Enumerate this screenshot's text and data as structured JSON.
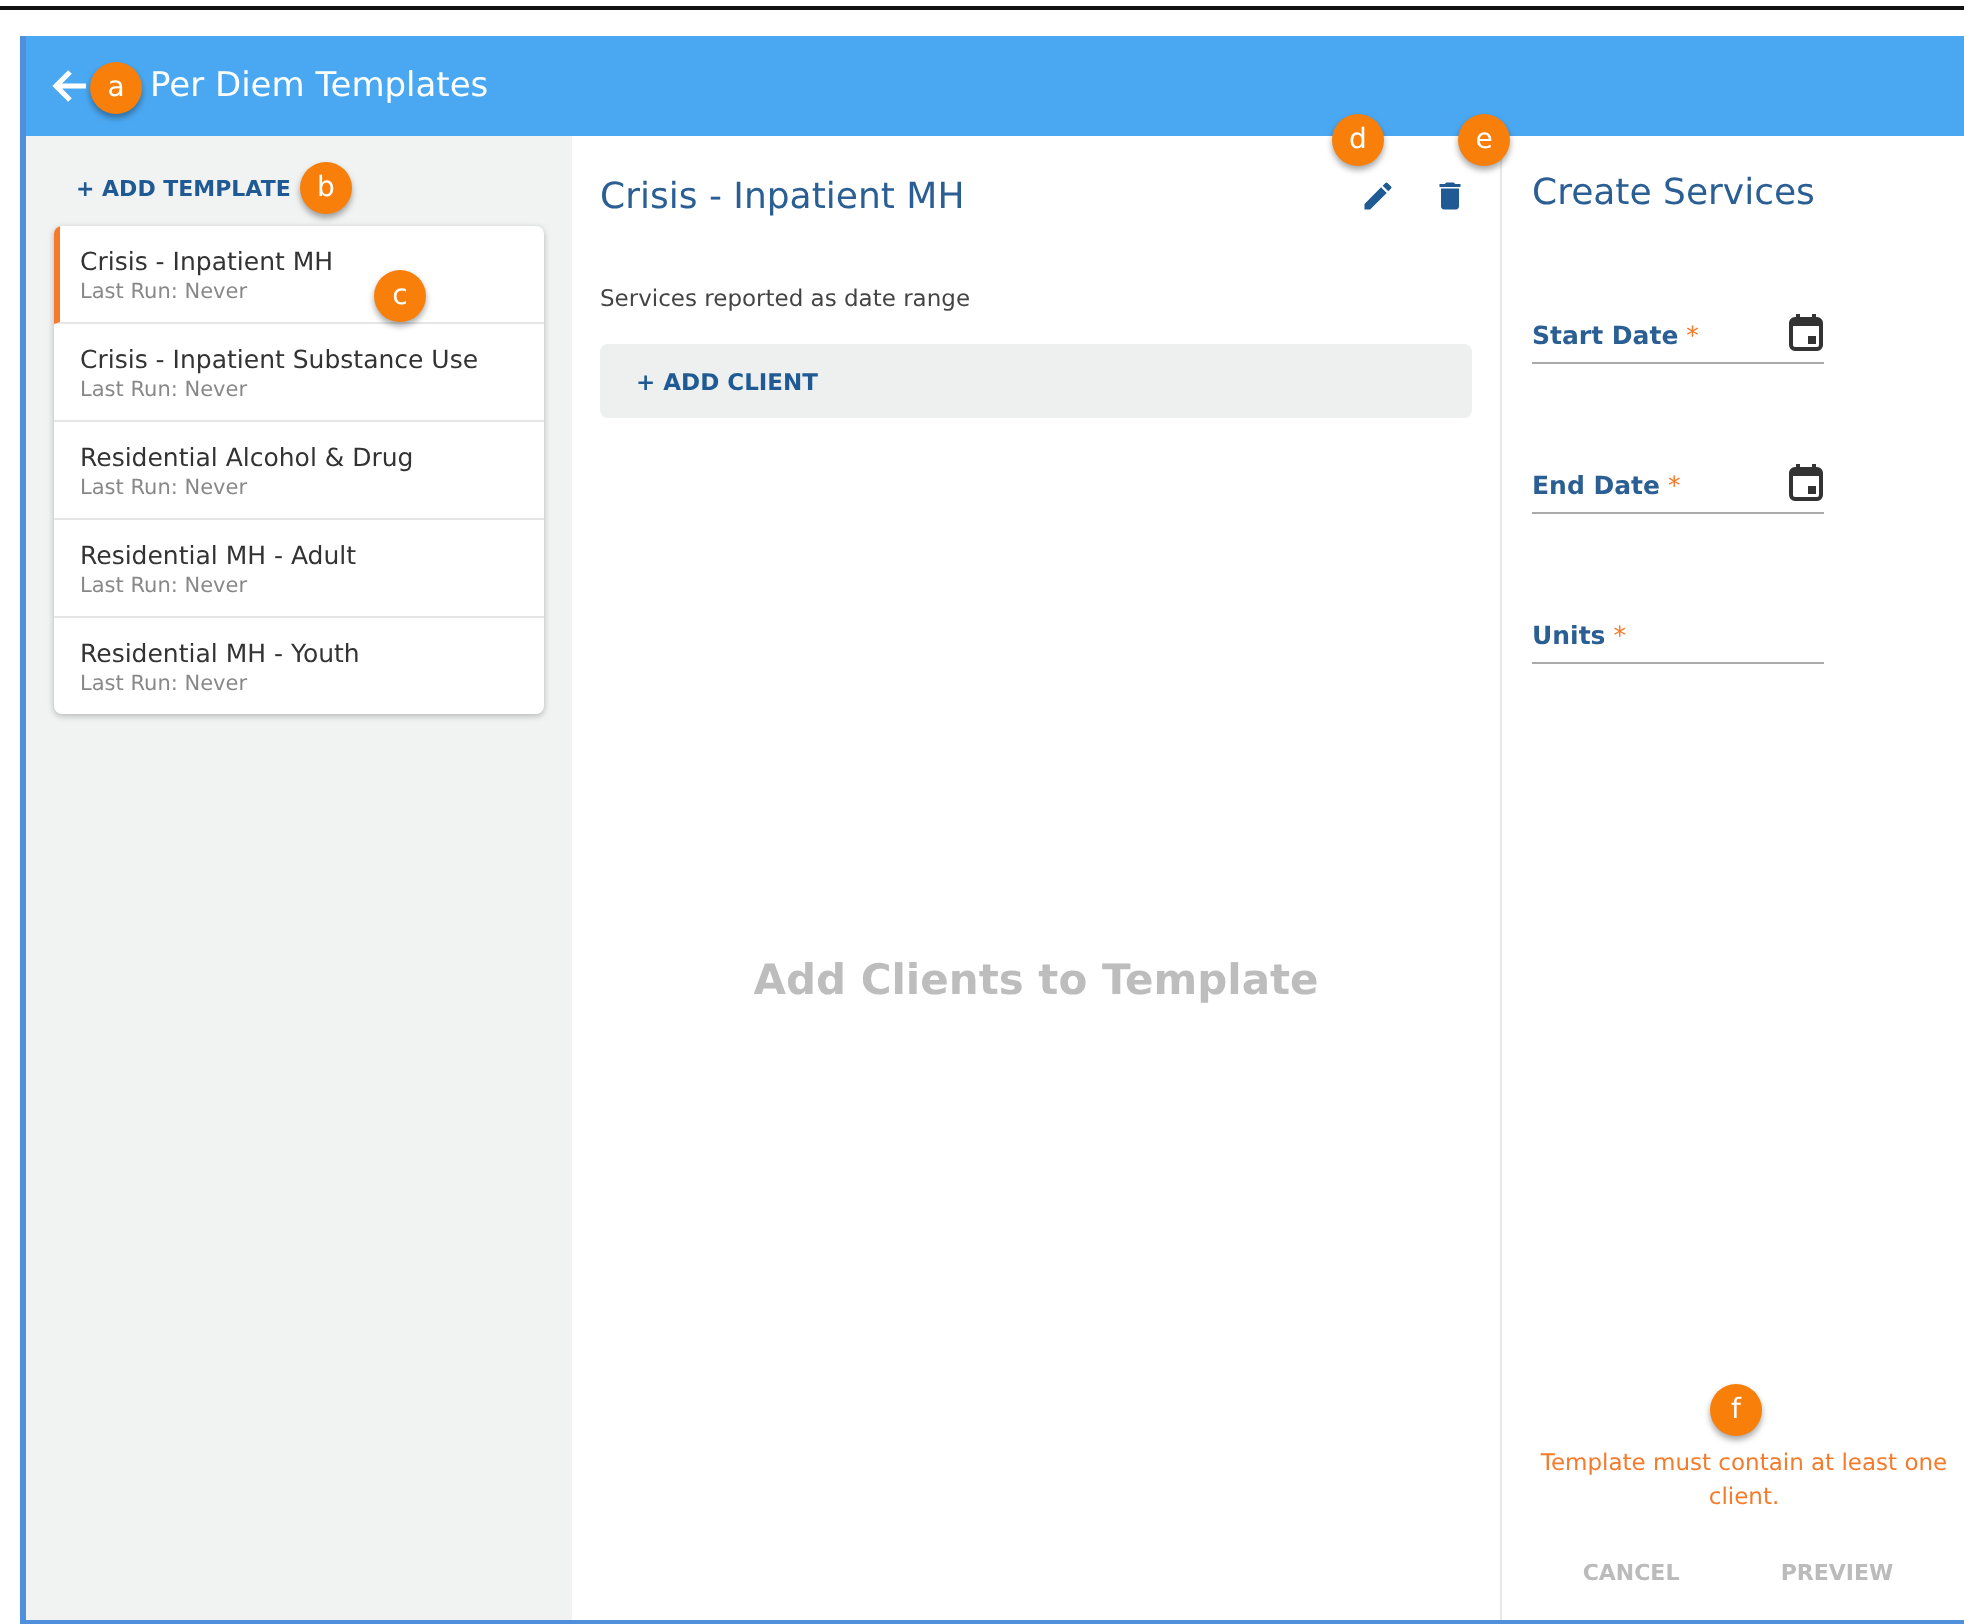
{
  "header": {
    "title": "Per Diem Templates"
  },
  "sidebar": {
    "add_button": "+ ADD TEMPLATE",
    "templates": [
      {
        "name": "Crisis - Inpatient MH",
        "last_run": "Last Run: Never",
        "selected": true
      },
      {
        "name": "Crisis - Inpatient Substance Use",
        "last_run": "Last Run: Never",
        "selected": false
      },
      {
        "name": "Residential Alcohol & Drug",
        "last_run": "Last Run: Never",
        "selected": false
      },
      {
        "name": "Residential MH - Adult",
        "last_run": "Last Run: Never",
        "selected": false
      },
      {
        "name": "Residential MH - Youth",
        "last_run": "Last Run: Never",
        "selected": false
      }
    ]
  },
  "detail": {
    "title": "Crisis - Inpatient MH",
    "subtitle": "Services reported as date range",
    "add_client": "+ ADD CLIENT",
    "empty_message": "Add Clients to Template"
  },
  "create_services": {
    "title": "Create Services",
    "fields": [
      {
        "label": "Start Date",
        "required_mark": "*",
        "kind": "date"
      },
      {
        "label": "End Date",
        "required_mark": "*",
        "kind": "date"
      },
      {
        "label": "Units",
        "required_mark": "*",
        "kind": "text"
      }
    ],
    "error": "Template must contain at least one client.",
    "buttons": [
      {
        "label": "CANCEL",
        "disabled": true
      },
      {
        "label": "PREVIEW",
        "disabled": true
      }
    ]
  },
  "callouts": [
    {
      "letter": "a"
    },
    {
      "letter": "b"
    },
    {
      "letter": "c"
    },
    {
      "letter": "d"
    },
    {
      "letter": "e"
    },
    {
      "letter": "f"
    }
  ]
}
